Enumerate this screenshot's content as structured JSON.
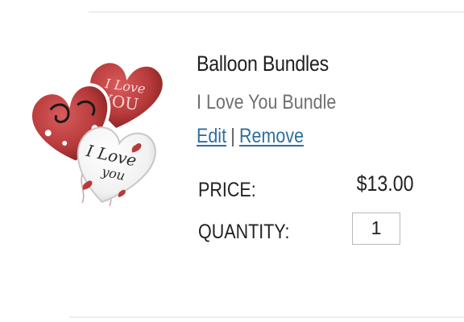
{
  "item": {
    "title": "Balloon Bundles",
    "subtitle": "I Love You Bundle",
    "edit_label": "Edit",
    "separator": "|",
    "remove_label": "Remove",
    "price_label": "PRICE:",
    "price_value": "$13.00",
    "quantity_label": "QUANTITY:",
    "quantity_value": "1",
    "image_icon": "heart-balloons-image"
  },
  "colors": {
    "link": "#2f6f9f",
    "title": "#1f1f1f",
    "subtitle": "#6f6f6f",
    "balloon_red": "#b83a3a"
  }
}
